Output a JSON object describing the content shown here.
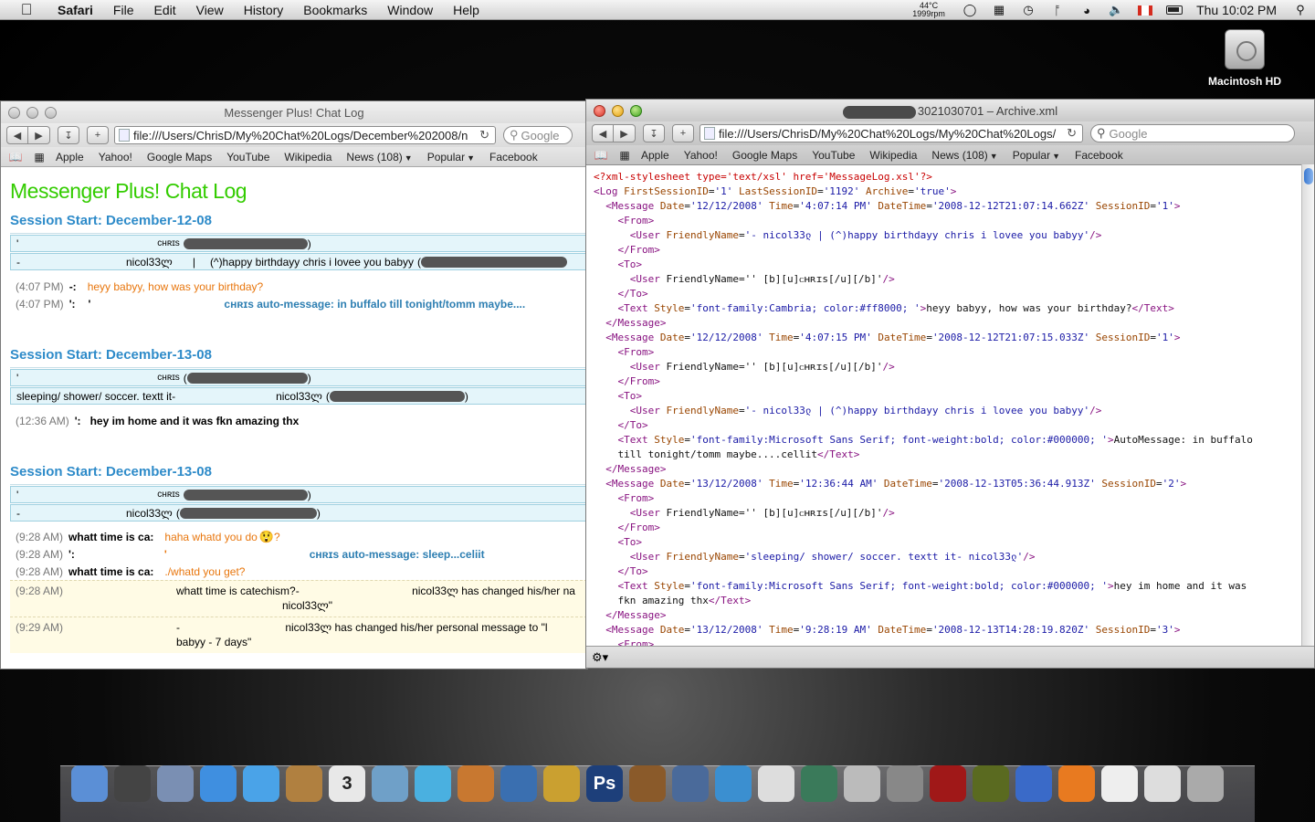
{
  "menubar": {
    "app": "Safari",
    "items": [
      "File",
      "Edit",
      "View",
      "History",
      "Bookmarks",
      "Window",
      "Help"
    ],
    "temp": "44°C",
    "rpm": "1999rpm",
    "clock": "Thu 10:02 PM"
  },
  "desktop": {
    "hd_label": "Macintosh HD"
  },
  "left_window": {
    "title": "Messenger Plus! Chat Log",
    "url": "file:///Users/ChrisD/My%20Chat%20Logs/December%202008/n",
    "search_placeholder": "Google",
    "bookmarks": [
      "Apple",
      "Yahoo!",
      "Google Maps",
      "YouTube",
      "Wikipedia",
      "News (108)",
      "Popular",
      "Facebook"
    ],
    "page_title": "Messenger Plus! Chat Log",
    "sessions": [
      {
        "header": "Session Start: December-12-08",
        "p1_prefix": "'",
        "p1_name": "ᴄʜʀɪs",
        "p1_close": ")",
        "p2_prefix": "-",
        "p2_name": "nicol33ლ",
        "p2_sep": "|",
        "p2_status": "(^)happy birthdayy chris i lovee you babyy",
        "p2_open": "(",
        "m1_time": "(4:07 PM)",
        "m1_sender": "-:",
        "m1_text": "heyy babyy, how was your birthday?",
        "m2_time": "(4:07 PM)",
        "m2_sender": "':",
        "m2_sender_mark": "'",
        "m2_text": "ᴄʜʀɪs auto-message: in buffalo till tonight/tomm maybe...."
      },
      {
        "header": "Session Start: December-13-08",
        "p1_prefix": "'",
        "p1_name": "ᴄʜʀɪs",
        "p1_open": "(",
        "p1_close": ")",
        "p2_prefix": "sleeping/ shower/ soccer. textt it-",
        "p2_name": "nicol33ლ",
        "p2_open": "(",
        "p2_close": ")",
        "m1_time": "(12:36 AM)",
        "m1_sender": "':",
        "m1_text": "hey im home and it was fkn amazing thx"
      },
      {
        "header": "Session Start: December-13-08",
        "p1_prefix": "'",
        "p1_name": "ᴄʜʀɪs",
        "p1_close": ")",
        "p2_prefix": "-",
        "p2_name": "nicol33ლ",
        "p2_open": "(",
        "p2_close": ")",
        "m1_time": "(9:28 AM)",
        "m1_sender": "whatt time is ca:",
        "m1_text": "haha whatd you do",
        "m1_emoticon": "😲",
        "m1_end": "?",
        "m2_time": "(9:28 AM)",
        "m2_sender": "':",
        "m2_mark": "'",
        "m2_text": "ᴄʜʀɪs auto-message: sleep...celiit",
        "m3_time": "(9:28 AM)",
        "m3_sender": "whatt time is ca:",
        "m3_text": "./whatd you get?",
        "s1_time": "(9:28 AM)",
        "s1_left": "whatt time is catechism?-",
        "s1_right": "nicol33ლ has changed his/her na",
        "s1_line2": "nicol33ლ\"",
        "s2_time": "(9:29 AM)",
        "s2_left": "-",
        "s2_right": "nicol33ლ has changed his/her personal message to \"l",
        "s2_line2": "babyy  - 7 days\""
      }
    ]
  },
  "right_window": {
    "title_suffix": "3021030701 – Archive.xml",
    "url": "file:///Users/ChrisD/My%20Chat%20Logs/My%20Chat%20Logs/",
    "search_placeholder": "Google",
    "bookmarks": [
      "Apple",
      "Yahoo!",
      "Google Maps",
      "YouTube",
      "Wikipedia",
      "News (108)",
      "Popular",
      "Facebook"
    ],
    "xml_lines": [
      "<?xml-stylesheet type='text/xsl' href='MessageLog.xsl'?>",
      "<Log FirstSessionID='1' LastSessionID='1192' Archive='true'>",
      "  <Message Date='12/12/2008' Time='4:07:14 PM' DateTime='2008-12-12T21:07:14.662Z' SessionID='1'>",
      "    <From>",
      "      <User FriendlyName='- nicol33ლ | (^)happy birthdayy chris i lovee you babyy'/>",
      "    </From>",
      "    <To>",
      "      <User FriendlyName='' [b][u]ᴄʜʀɪs[/u][/b]'/>",
      "    </To>",
      "    <Text Style='font-family:Cambria; color:#ff8000; '>heyy babyy, how was your birthday?</Text>",
      "  </Message>",
      "  <Message Date='12/12/2008' Time='4:07:15 PM' DateTime='2008-12-12T21:07:15.033Z' SessionID='1'>",
      "    <From>",
      "      <User FriendlyName='' [b][u]ᴄʜʀɪs[/u][/b]'/>",
      "    </From>",
      "    <To>",
      "      <User FriendlyName='- nicol33ლ | (^)happy birthdayy chris i lovee you babyy'/>",
      "    </To>",
      "    <Text Style='font-family:Microsoft Sans Serif; font-weight:bold; color:#000000; '>AutoMessage: in buffalo",
      "    till tonight/tomm maybe....cellit</Text>",
      "  </Message>",
      "  <Message Date='13/12/2008' Time='12:36:44 AM' DateTime='2008-12-13T05:36:44.913Z' SessionID='2'>",
      "    <From>",
      "      <User FriendlyName='' [b][u]ᴄʜʀɪs[/u][/b]'/>",
      "    </From>",
      "    <To>",
      "      <User FriendlyName='sleeping/ shower/ soccer. textt it- nicol33ლ'/>",
      "    </To>",
      "    <Text Style='font-family:Microsoft Sans Serif; font-weight:bold; color:#000000; '>hey im home and it was",
      "    fkn amazing thx</Text>",
      "  </Message>",
      "  <Message Date='13/12/2008' Time='9:28:19 AM' DateTime='2008-12-13T14:28:19.820Z' SessionID='3'>",
      "    <From>"
    ]
  },
  "dock": {
    "icons": [
      "finder-icon",
      "dashboard-icon",
      "mail-icon",
      "safari-icon",
      "ichat-icon",
      "address-book-icon",
      "ical-icon",
      "iphoto-icon",
      "itunes-icon",
      "preview-icon",
      "dvd-player-icon",
      "imovie-icon",
      "photoshop-icon",
      "garageband-icon",
      "spaces-icon",
      "msn-messenger-icon",
      "skype-icon",
      "time-machine-icon",
      "utility-icon",
      "system-preferences-icon",
      "photo-booth-icon",
      "game-icon",
      "word-icon",
      "powerpoint-icon",
      "textedit-icon",
      "documents-stack-icon",
      "trash-icon"
    ],
    "ical_day": "3",
    "ps_label": "Ps"
  },
  "colors": {
    "chat_title": "#33cc00",
    "session_header": "#2e8bc9",
    "orange_text": "#e8760d"
  }
}
